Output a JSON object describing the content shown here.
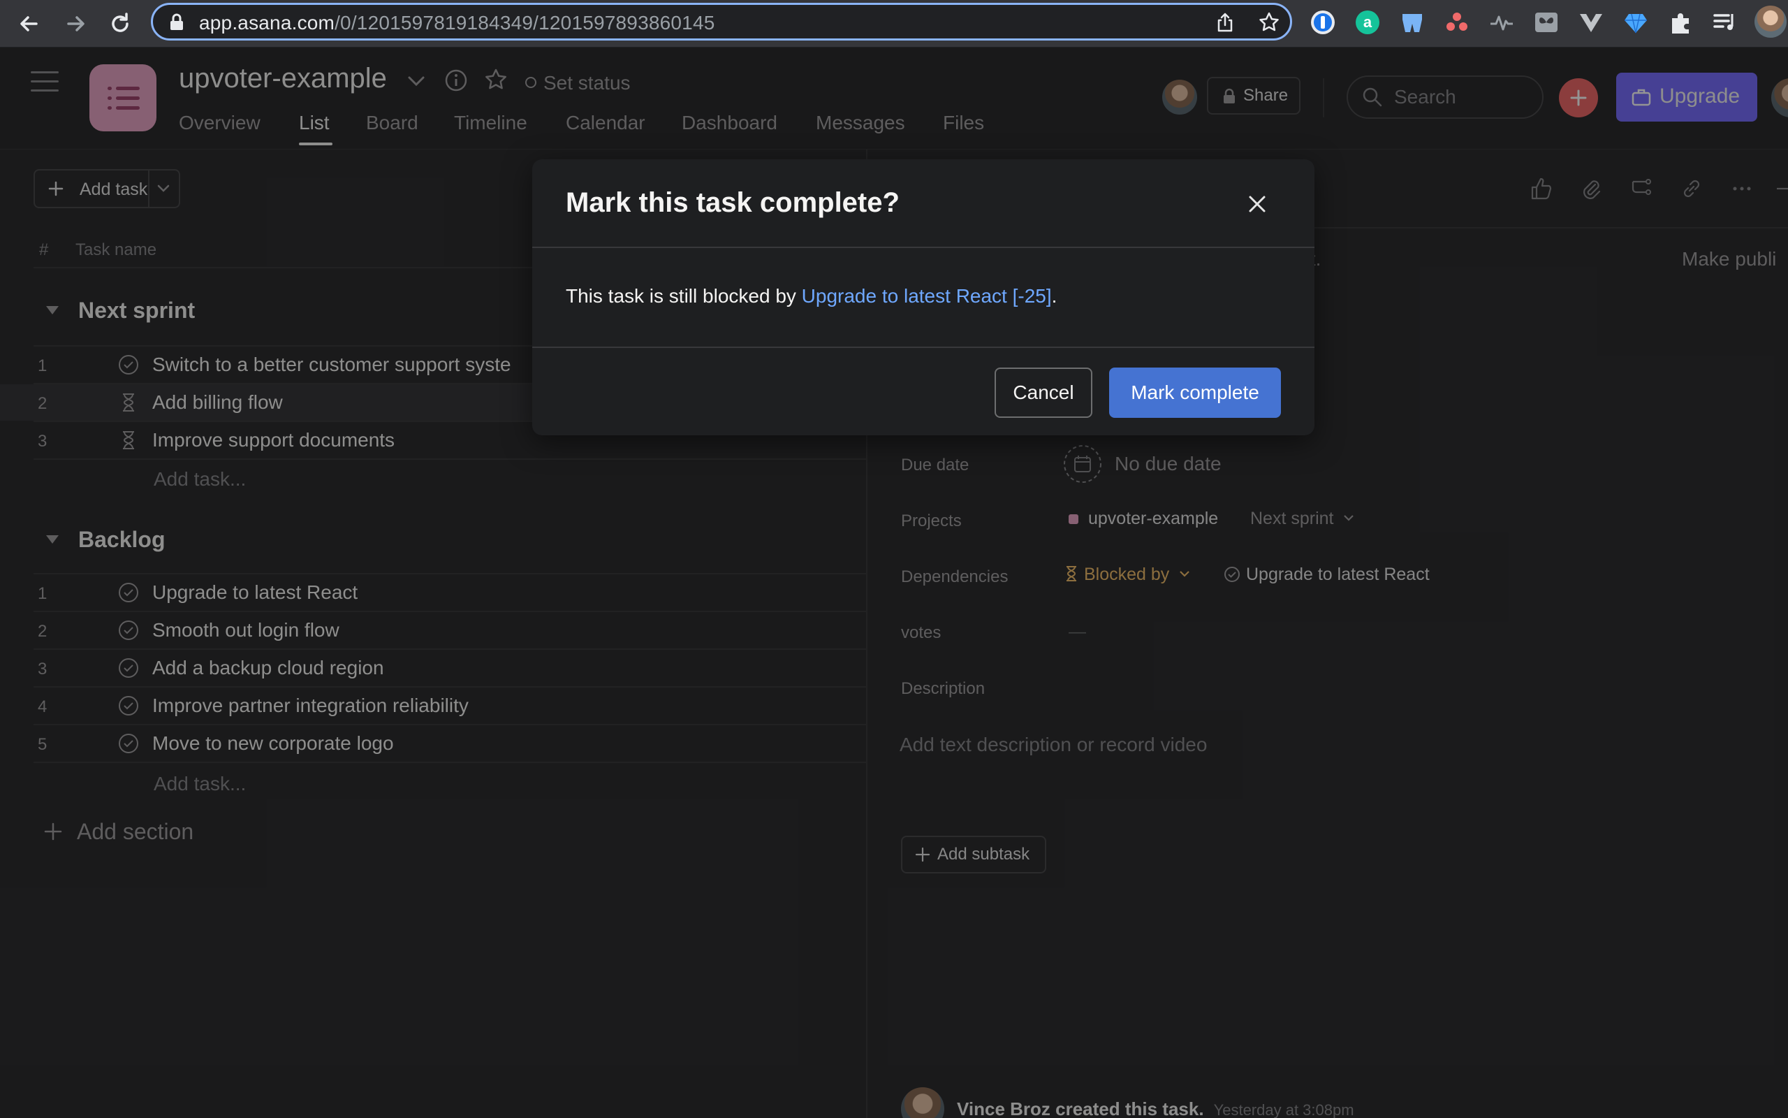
{
  "browser": {
    "url_host": "app.asana.com",
    "url_path": "/0/1201597819184349/1201597893860145"
  },
  "header": {
    "project_title": "upvoter-example",
    "set_status": "Set status",
    "tabs": [
      "Overview",
      "List",
      "Board",
      "Timeline",
      "Calendar",
      "Dashboard",
      "Messages",
      "Files"
    ],
    "active_tab": "List",
    "share_label": "Share",
    "search_placeholder": "Search",
    "upgrade_label": "Upgrade"
  },
  "list": {
    "add_task_label": "Add task",
    "columns": {
      "num": "#",
      "name": "Task name"
    },
    "sections": [
      {
        "title": "Next sprint",
        "tasks": [
          {
            "num": "1",
            "name": "Switch to a better customer support syste",
            "icon": "check-circle-icon"
          },
          {
            "num": "2",
            "name": "Add billing flow",
            "icon": "hourglass-icon"
          },
          {
            "num": "3",
            "name": "Improve support documents",
            "icon": "hourglass-icon"
          }
        ],
        "add_task": "Add task..."
      },
      {
        "title": "Backlog",
        "tasks": [
          {
            "num": "1",
            "name": "Upgrade to latest React",
            "icon": "check-circle-icon"
          },
          {
            "num": "2",
            "name": "Smooth out login flow",
            "icon": "check-circle-icon"
          },
          {
            "num": "3",
            "name": "Add a backup cloud region",
            "icon": "check-circle-icon"
          },
          {
            "num": "4",
            "name": "Improve partner integration reliability",
            "icon": "check-circle-icon"
          },
          {
            "num": "5",
            "name": "Move to new corporate logo",
            "icon": "check-circle-icon"
          }
        ],
        "add_task": "Add task..."
      }
    ],
    "add_section": "Add section"
  },
  "detail": {
    "banner_fragment": "ject.",
    "make_public": "Make publi",
    "due_date_label": "Due date",
    "due_date_value": "No due date",
    "projects_label": "Projects",
    "project_name": "upvoter-example",
    "project_section": "Next sprint",
    "dependencies_label": "Dependencies",
    "blocked_by": "Blocked by",
    "blocking_task": "Upgrade to latest React",
    "votes_label": "votes",
    "votes_value": "—",
    "description_label": "Description",
    "description_placeholder": "Add text description or record video",
    "add_subtask": "Add subtask",
    "created_by": "Vince Broz created this task.",
    "created_time": "Yesterday at 3:08pm"
  },
  "modal": {
    "title": "Mark this task complete?",
    "body_prefix": "This task is still blocked by ",
    "body_link": "Upgrade to latest React [-25]",
    "body_suffix": ".",
    "cancel_label": "Cancel",
    "confirm_label": "Mark complete"
  },
  "colors": {
    "accent_blue": "#4573d2",
    "link_blue": "#6fa8ff",
    "blocked_amber": "#f1bd6c",
    "project_pink": "#e8a6c6"
  }
}
